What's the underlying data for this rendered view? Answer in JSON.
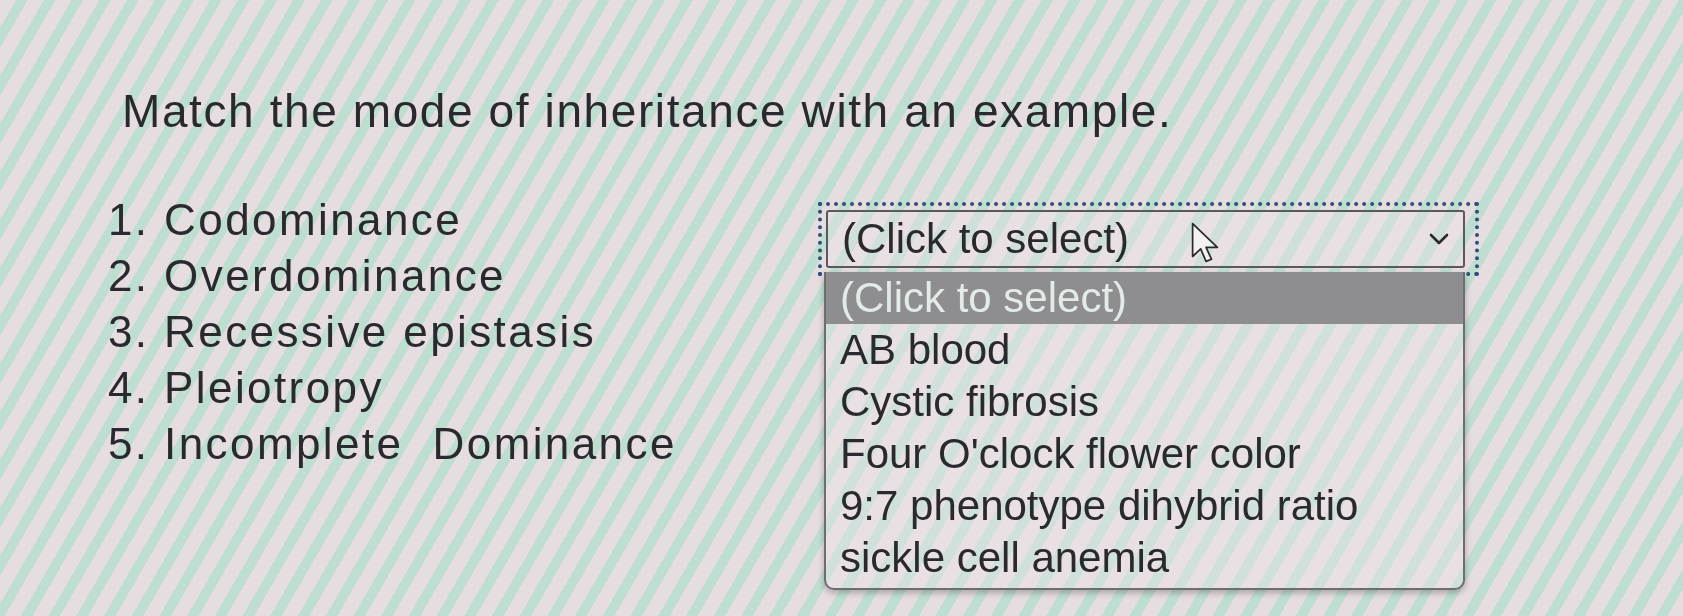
{
  "question": {
    "prompt": "Match the mode of inheritance with an example."
  },
  "terms": [
    "1. Codominance",
    "2. Overdominance",
    "3. Recessive epistasis",
    "4. Pleiotropy",
    "5. Incomplete  Dominance"
  ],
  "dropdown": {
    "value": "(Click to select)",
    "focused": true,
    "expanded": true,
    "options": [
      {
        "label": "(Click to select)",
        "selected": true
      },
      {
        "label": "AB blood",
        "selected": false
      },
      {
        "label": "Cystic fibrosis",
        "selected": false
      },
      {
        "label": "Four O'clock flower color",
        "selected": false
      },
      {
        "label": "9:7 phenotype dihybrid ratio",
        "selected": false
      },
      {
        "label": "sickle cell anemia",
        "selected": false
      }
    ]
  }
}
